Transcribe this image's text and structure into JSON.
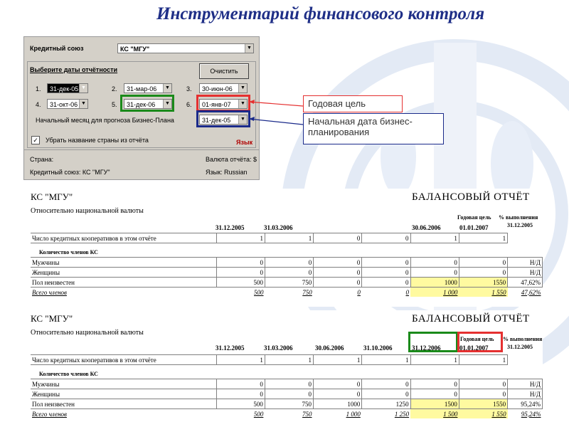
{
  "title": "Инструментарий финансового контроля",
  "colors": {
    "title": "#1f2f87",
    "highlight_red": "#e53030",
    "highlight_green": "#1a8a1a",
    "highlight_blue": "#1a2a8a",
    "yellow": "#fffaa0"
  },
  "dialog": {
    "union_label": "Кредитный союз",
    "union_value": "КС \"МГУ\"",
    "dates_group_label": "Выберите даты отчётности",
    "clear_button": "Очистить",
    "dates": [
      {
        "num": "1.",
        "value": "31-дек-05"
      },
      {
        "num": "2.",
        "value": "31-мар-06"
      },
      {
        "num": "3.",
        "value": "30-июн-06"
      },
      {
        "num": "4.",
        "value": "31-окт-06"
      },
      {
        "num": "5.",
        "value": "31-дек-06"
      },
      {
        "num": "6.",
        "value": "01-янв-07"
      }
    ],
    "plan_label": "Начальный месяц для прогноза Бизнес-Плана",
    "plan_value": "31-дек-05",
    "checkbox_label": "Убрать название страны из отчёта",
    "language_label": "Язык",
    "status": {
      "country": "Страна:",
      "currency": "Валюта отчёта: $",
      "union": "Кредитный союз: КС \"МГУ\"",
      "language": "Язык: Russian"
    }
  },
  "callouts": {
    "goal": "Годовая цель",
    "plan_start": "Начальная дата бизнес-планирования"
  },
  "report1": {
    "name": "КС \"МГУ\"",
    "title": "БАЛАНСОВЫЙ ОТЧЁТ",
    "subtitle": "Относительно национальной валюты",
    "head_goal": "Годовая цель",
    "head_pct": "% выполнения",
    "head_pct_date": "31.12.2005",
    "dates": [
      "31.12.2005",
      "31.03.2006",
      "",
      "",
      "30.06.2006",
      "01.01.2007"
    ],
    "row_coops": {
      "label": "Число кредитных кооперативов в этом отчёте",
      "values": [
        "1",
        "1",
        "0",
        "0",
        "1",
        "1",
        ""
      ]
    },
    "section": "Количество членов КС",
    "rows": [
      {
        "label": "Мужчины",
        "values": [
          "0",
          "0",
          "0",
          "0",
          "0",
          "0",
          "Н/Д"
        ]
      },
      {
        "label": "Женщины",
        "values": [
          "0",
          "0",
          "0",
          "0",
          "0",
          "0",
          "Н/Д"
        ]
      },
      {
        "label": "Пол неизвестен",
        "values": [
          "500",
          "750",
          "0",
          "0",
          "1000",
          "1550",
          "47,62%"
        ]
      }
    ],
    "total": {
      "label": "Всего членов",
      "values": [
        "500",
        "750",
        "0",
        "0",
        "1 000",
        "1 550",
        "47,62%"
      ]
    }
  },
  "report2": {
    "name": "КС \"МГУ\"",
    "title": "БАЛАНСОВЫЙ ОТЧЁТ",
    "subtitle": "Относительно национальной валюты",
    "head_goal": "Годовая цель",
    "head_pct": "% выполнения",
    "head_pct_date": "31.12.2005",
    "dates": [
      "31.12.2005",
      "31.03.2006",
      "30.06.2006",
      "31.10.2006",
      "31.12.2006",
      "01.01.2007"
    ],
    "row_coops": {
      "label": "Число кредитных кооперативов в этом отчёте",
      "values": [
        "1",
        "1",
        "1",
        "1",
        "1",
        "1",
        ""
      ]
    },
    "section": "Количество членов КС",
    "rows": [
      {
        "label": "Мужчины",
        "values": [
          "0",
          "0",
          "0",
          "0",
          "0",
          "0",
          "Н/Д"
        ]
      },
      {
        "label": "Женщины",
        "values": [
          "0",
          "0",
          "0",
          "0",
          "0",
          "0",
          "Н/Д"
        ]
      },
      {
        "label": "Пол неизвестен",
        "values": [
          "500",
          "750",
          "1000",
          "1250",
          "1500",
          "1550",
          "95,24%"
        ]
      }
    ],
    "total": {
      "label": "Всего членов",
      "values": [
        "500",
        "750",
        "1 000",
        "1 250",
        "1 500",
        "1 550",
        "95,24%"
      ]
    }
  }
}
